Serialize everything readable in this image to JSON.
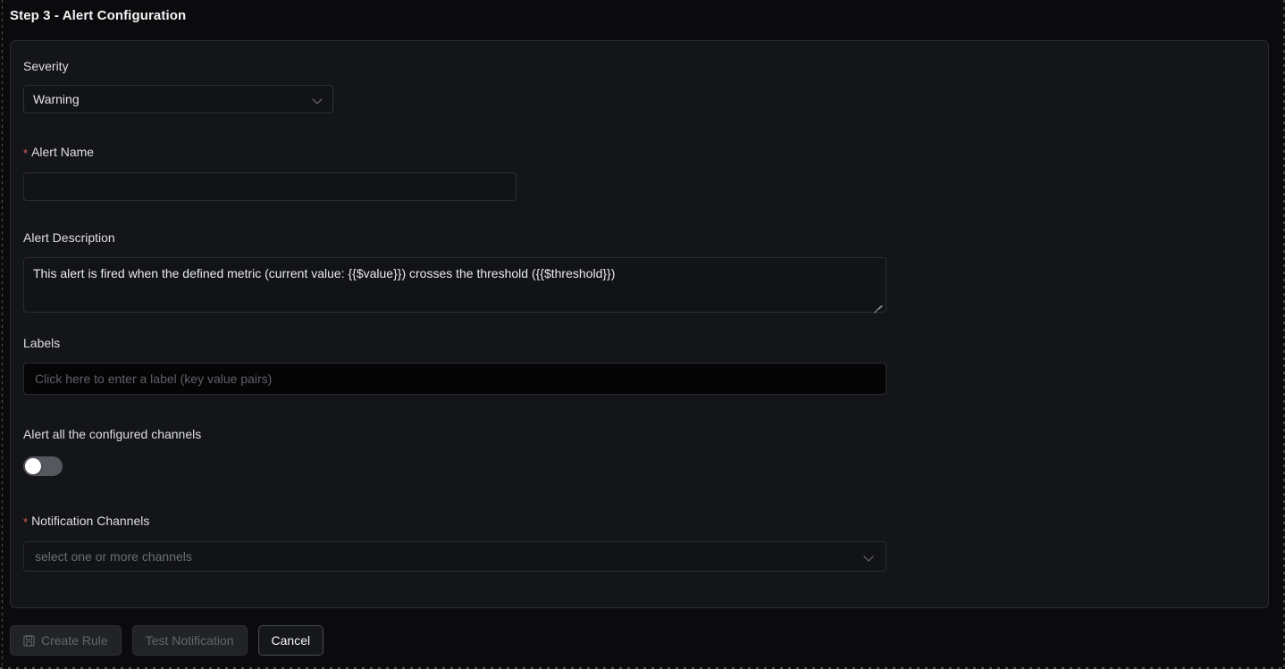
{
  "header": {
    "title": "Step 3 - Alert Configuration"
  },
  "form": {
    "severity": {
      "label": "Severity",
      "value": "Warning",
      "icon": "chevron-down-icon"
    },
    "alert_name": {
      "label": "Alert Name",
      "required_marker": "*",
      "value": "",
      "placeholder": ""
    },
    "alert_description": {
      "label": "Alert Description",
      "value": "This alert is fired when the defined metric (current value: {{$value}}) crosses the threshold ({{$threshold}})"
    },
    "labels": {
      "label": "Labels",
      "value": "",
      "placeholder": "Click here to enter a label (key value pairs)"
    },
    "alert_all_channels": {
      "label": "Alert all the configured channels",
      "state": "off"
    },
    "notification_channels": {
      "label": "Notification Channels",
      "required_marker": "*",
      "value": "",
      "placeholder": "select one or more channels",
      "icon": "chevron-down-icon"
    }
  },
  "footer": {
    "create_rule": {
      "label": "Create Rule",
      "icon": "save-icon",
      "state": "disabled"
    },
    "test_notification": {
      "label": "Test Notification",
      "state": "disabled"
    },
    "cancel": {
      "label": "Cancel",
      "state": "enabled"
    }
  },
  "colors": {
    "page_background": "#0b0b0d",
    "card_background": "#141519",
    "card_border": "#2a2c31",
    "input_background": "#121317",
    "labels_input_background": "#050506",
    "required_marker": "#e05c5c",
    "toggle_track_off": "#55585e",
    "toggle_knob": "#ffffff",
    "text_primary": "#e8e9ea",
    "text_muted": "#6b6e74"
  }
}
